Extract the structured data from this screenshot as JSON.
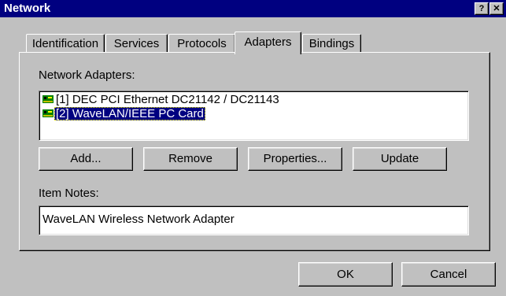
{
  "window": {
    "title": "Network",
    "help_glyph": "?",
    "close_glyph": "✕"
  },
  "tabs": [
    {
      "label": "Identification",
      "active": false
    },
    {
      "label": "Services",
      "active": false
    },
    {
      "label": "Protocols",
      "active": false
    },
    {
      "label": "Adapters",
      "active": true
    },
    {
      "label": "Bindings",
      "active": false
    }
  ],
  "adapters": {
    "group_label": "Network Adapters:",
    "items": [
      {
        "label": "[1] DEC PCI Ethernet DC21142 / DC21143",
        "selected": false,
        "icon": "network-card-icon"
      },
      {
        "label": "[2] WaveLAN/IEEE PC Card",
        "selected": true,
        "icon": "network-card-icon"
      }
    ]
  },
  "buttons": {
    "add": "Add...",
    "remove": "Remove",
    "properties": "Properties...",
    "update": "Update"
  },
  "item_notes": {
    "label": "Item Notes:",
    "value": "WaveLAN Wireless Network Adapter"
  },
  "dialog_buttons": {
    "ok": "OK",
    "cancel": "Cancel"
  },
  "colors": {
    "title_bar": "#000080",
    "face": "#c0c0c0",
    "selection": "#000080"
  }
}
